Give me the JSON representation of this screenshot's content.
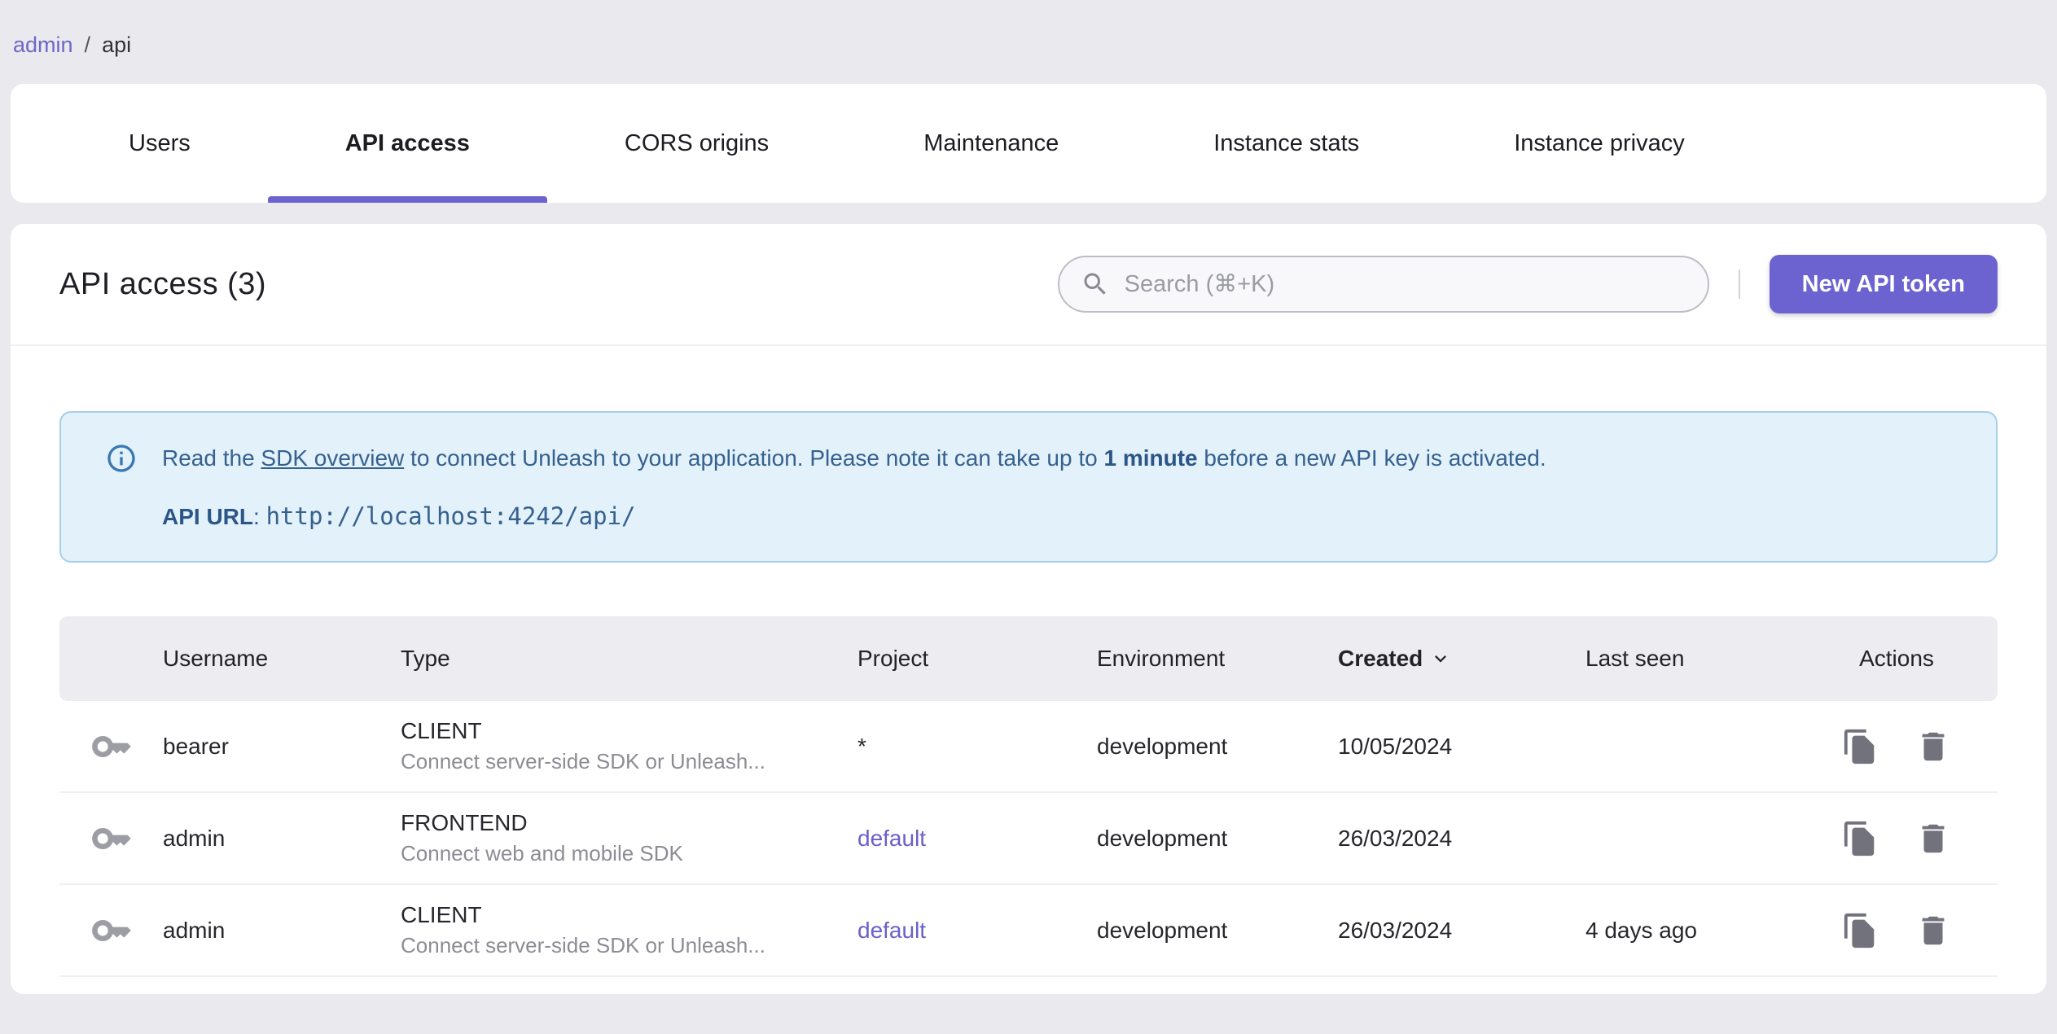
{
  "breadcrumb": {
    "link": "admin",
    "separator": "/",
    "current": "api"
  },
  "tabs": [
    {
      "label": "Users",
      "active": false
    },
    {
      "label": "API access",
      "active": true
    },
    {
      "label": "CORS origins",
      "active": false
    },
    {
      "label": "Maintenance",
      "active": false
    },
    {
      "label": "Instance stats",
      "active": false
    },
    {
      "label": "Instance privacy",
      "active": false
    }
  ],
  "page_header": {
    "title": "API access (3)",
    "search_placeholder": "Search (⌘+K)",
    "new_token_button": "New API token"
  },
  "banner": {
    "text_prefix": "Read the ",
    "link_text": "SDK overview",
    "text_middle": " to connect Unleash to your application. Please note it can take up to ",
    "bold_text": "1 minute",
    "text_suffix": " before a new API key is activated.",
    "api_url_label": "API URL",
    "api_url_separator": ": ",
    "api_url": "http://localhost:4242/api/"
  },
  "table": {
    "columns": [
      "Username",
      "Type",
      "Project",
      "Environment",
      "Created",
      "Last seen",
      "Actions"
    ],
    "sorted_column": "Created",
    "sort_direction": "desc",
    "rows": [
      {
        "username": "bearer",
        "type": "CLIENT",
        "type_description": "Connect server-side SDK or Unleash...",
        "project": "*",
        "project_is_link": false,
        "environment": "development",
        "created": "10/05/2024",
        "last_seen": ""
      },
      {
        "username": "admin",
        "type": "FRONTEND",
        "type_description": "Connect web and mobile SDK",
        "project": "default",
        "project_is_link": true,
        "environment": "development",
        "created": "26/03/2024",
        "last_seen": ""
      },
      {
        "username": "admin",
        "type": "CLIENT",
        "type_description": "Connect server-side SDK or Unleash...",
        "project": "default",
        "project_is_link": true,
        "environment": "development",
        "created": "26/03/2024",
        "last_seen": "4 days ago"
      }
    ]
  },
  "icons": {
    "search": "magnifier",
    "info": "info-circle",
    "key": "token-key",
    "copy": "copy-document",
    "delete": "trash-can",
    "sort": "chevron-down"
  },
  "colors": {
    "page_background": "#E9E9EE",
    "card_background": "#FFFFFF",
    "primary_purple": "#6C63D1",
    "breadcrumb_link": "#6D68C6",
    "project_link": "#6A60C8",
    "banner_background": "#E3F1FA",
    "banner_border": "#A6CFE9",
    "banner_text": "#35618F",
    "table_header_background": "#ECECF1",
    "icon_gray": "#72727C",
    "key_icon_gray": "#9D9DA5"
  }
}
